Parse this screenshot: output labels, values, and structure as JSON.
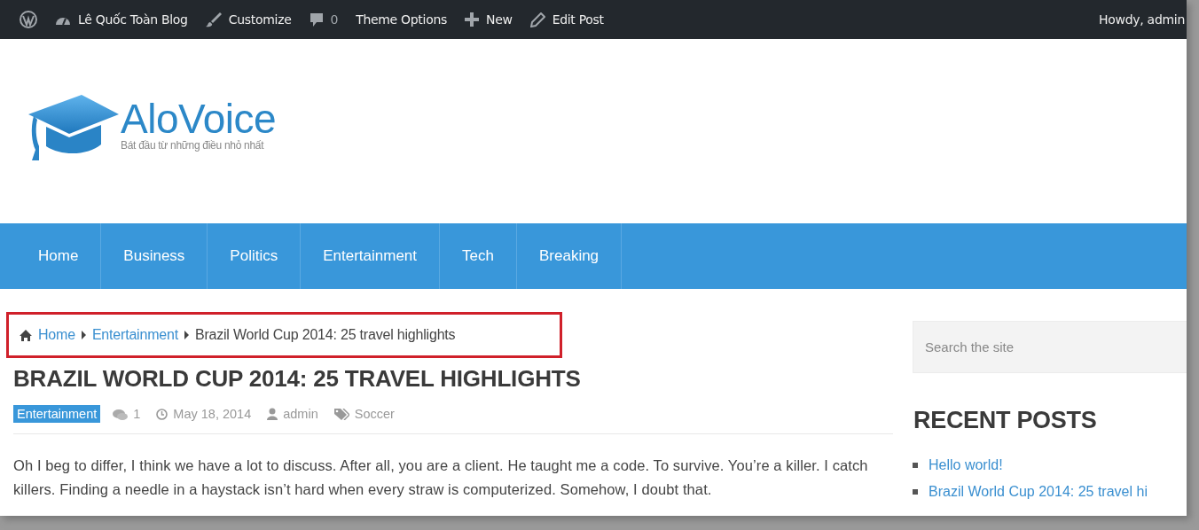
{
  "admin_bar": {
    "items": [
      {
        "kind": "logo"
      },
      {
        "kind": "site",
        "label": "Lê Quốc Toàn Blog"
      },
      {
        "kind": "customize",
        "label": "Customize"
      },
      {
        "kind": "comments",
        "label": "0"
      },
      {
        "kind": "text",
        "label": "Theme Options"
      },
      {
        "kind": "new",
        "label": "New"
      },
      {
        "kind": "edit",
        "label": "Edit Post"
      }
    ],
    "greeting": "Howdy, admin"
  },
  "header": {
    "site_title": "AloVoice",
    "tagline": "Bát đầu từ những điều nhỏ nhất"
  },
  "nav": {
    "items": [
      "Home",
      "Business",
      "Politics",
      "Entertainment",
      "Tech",
      "Breaking"
    ]
  },
  "breadcrumb": {
    "highlighted": true,
    "links": [
      "Home",
      "Entertainment"
    ],
    "current": "Brazil World Cup 2014: 25 travel highlights"
  },
  "post": {
    "title": "BRAZIL WORLD CUP 2014: 25 TRAVEL HIGHLIGHTS",
    "category": "Entertainment",
    "comments": "1",
    "date": "May 18, 2014",
    "author": "admin",
    "tag": "Soccer",
    "body": "Oh I beg to differ, I think we have a lot to discuss. After all, you are a client. He taught me a code. To survive. You’re a killer. I catch killers. Finding a needle in a haystack isn’t hard when every straw is computerized. Somehow, I doubt that."
  },
  "sidebar": {
    "search": {
      "placeholder": "Search the site"
    },
    "recent_posts": {
      "title": "RECENT POSTS",
      "items": [
        "Hello world!",
        "Brazil World Cup 2014: 25 travel hi"
      ]
    }
  }
}
